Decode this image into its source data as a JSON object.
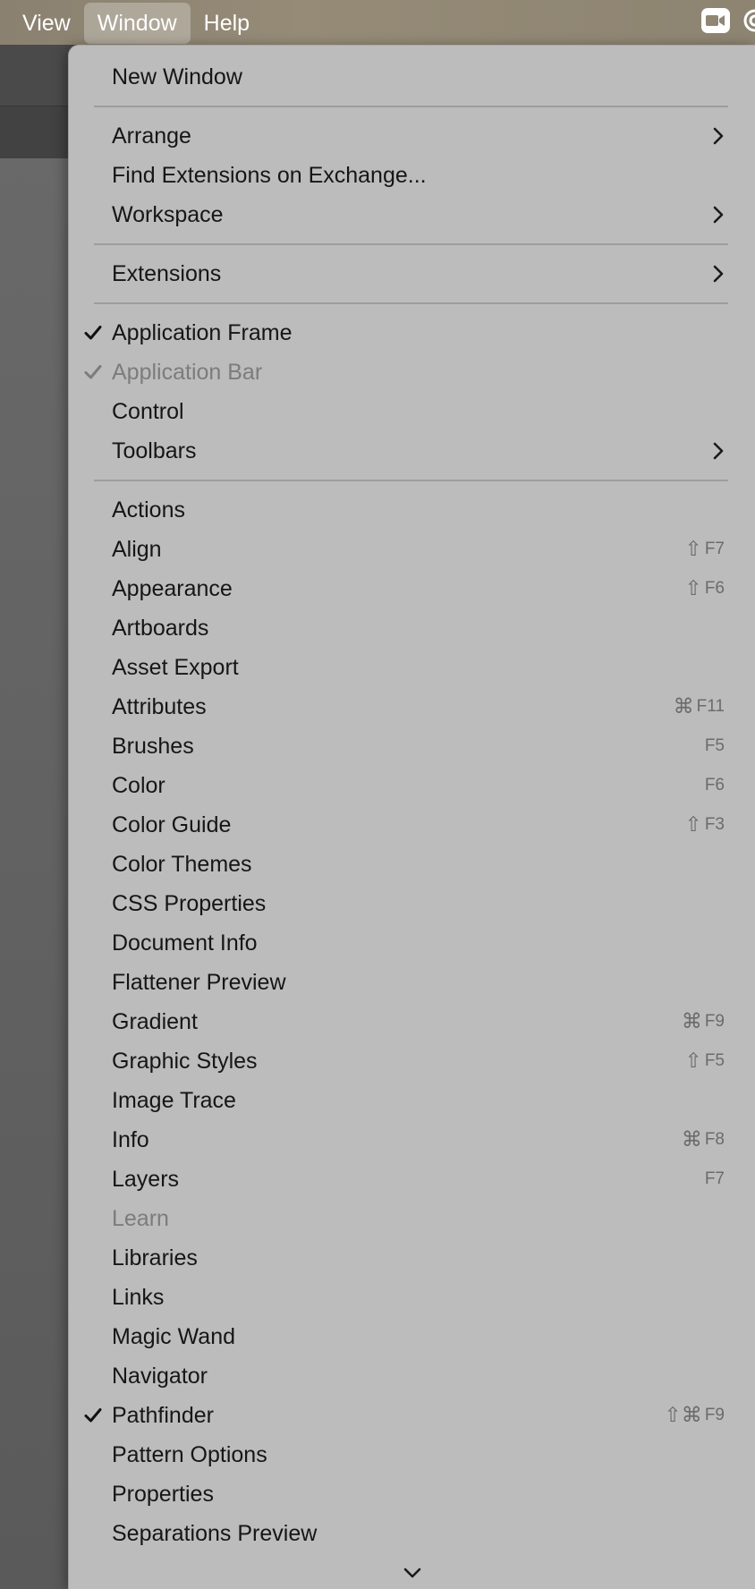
{
  "menubar": {
    "items": [
      "View",
      "Window",
      "Help"
    ],
    "active": "Window"
  },
  "status_icons": [
    "camera-icon",
    "cloud-icon"
  ],
  "menu": {
    "groups": [
      [
        {
          "label": "New Window"
        }
      ],
      [
        {
          "label": "Arrange",
          "submenu": true
        },
        {
          "label": "Find Extensions on Exchange..."
        },
        {
          "label": "Workspace",
          "submenu": true
        }
      ],
      [
        {
          "label": "Extensions",
          "submenu": true
        }
      ],
      [
        {
          "label": "Application Frame",
          "checked": true
        },
        {
          "label": "Application Bar",
          "checked": true,
          "disabled": true
        },
        {
          "label": "Control"
        },
        {
          "label": "Toolbars",
          "submenu": true
        }
      ],
      [
        {
          "label": "Actions"
        },
        {
          "label": "Align",
          "modifiers": "⇧",
          "key": "F7"
        },
        {
          "label": "Appearance",
          "modifiers": "⇧",
          "key": "F6"
        },
        {
          "label": "Artboards"
        },
        {
          "label": "Asset Export"
        },
        {
          "label": "Attributes",
          "modifiers": "⌘",
          "key": "F11"
        },
        {
          "label": "Brushes",
          "key": "F5"
        },
        {
          "label": "Color",
          "key": "F6"
        },
        {
          "label": "Color Guide",
          "modifiers": "⇧",
          "key": "F3"
        },
        {
          "label": "Color Themes"
        },
        {
          "label": "CSS Properties"
        },
        {
          "label": "Document Info"
        },
        {
          "label": "Flattener Preview"
        },
        {
          "label": "Gradient",
          "modifiers": "⌘",
          "key": "F9"
        },
        {
          "label": "Graphic Styles",
          "modifiers": "⇧",
          "key": "F5"
        },
        {
          "label": "Image Trace"
        },
        {
          "label": "Info",
          "modifiers": "⌘",
          "key": "F8"
        },
        {
          "label": "Layers",
          "key": "F7"
        },
        {
          "label": "Learn",
          "disabled": true
        },
        {
          "label": "Libraries"
        },
        {
          "label": "Links"
        },
        {
          "label": "Magic Wand"
        },
        {
          "label": "Navigator"
        },
        {
          "label": "Pathfinder",
          "checked": true,
          "modifiers": "⇧⌘",
          "key": "F9"
        },
        {
          "label": "Pattern Options"
        },
        {
          "label": "Properties"
        },
        {
          "label": "Separations Preview"
        }
      ]
    ],
    "scroll_indicator": "chevron-down-icon"
  },
  "colors": {
    "menu_bg": "#bcbcbc",
    "menu_text": "#161616",
    "disabled_text": "#7c7c7c",
    "shortcut_text": "#6b6b6b",
    "menubar_bg": "#8f8673"
  }
}
